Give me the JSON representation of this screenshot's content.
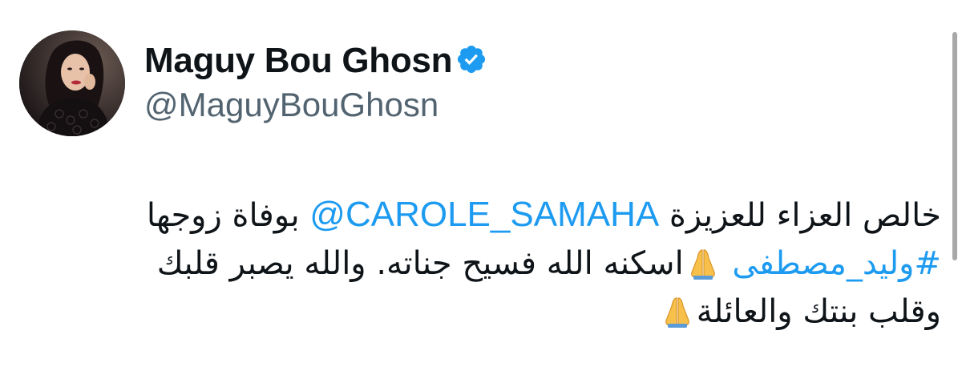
{
  "author": {
    "display_name": "Maguy Bou Ghosn",
    "handle": "@MaguyBouGhosn",
    "verified": true,
    "verified_color": "#1d9bf0"
  },
  "tweet": {
    "line1_prefix": "خالص العزاء للعزيزة ",
    "mention": "@CAROLE_SAMAHA",
    "line1_suffix": " بوفاة زوجها",
    "hashtag": "#وليد_مصطفى",
    "line2_text": "اسكنه الله فسيح جناته. والله يصبر قلبك",
    "line3_text": "وقلب بنتك والعائلة",
    "emoji": "folded-hands-emoji"
  },
  "colors": {
    "link": "#1d9bf0",
    "handle": "#536471",
    "text": "#0f1419"
  }
}
